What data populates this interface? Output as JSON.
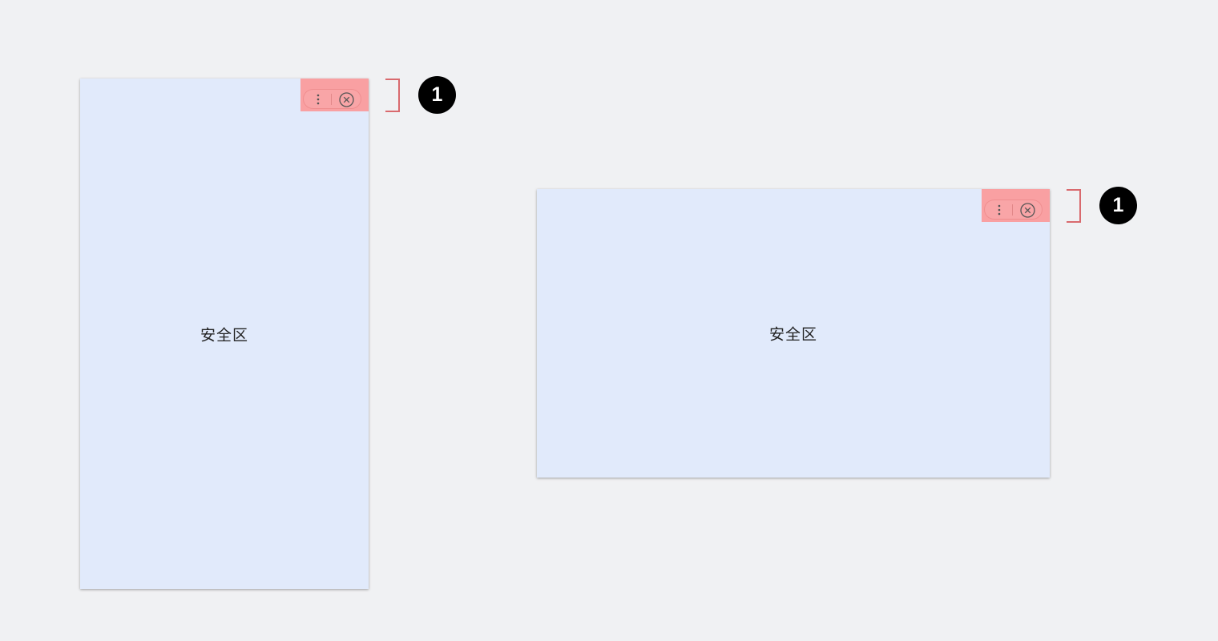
{
  "screens": [
    {
      "orientation": "portrait",
      "safe_area_label": "安全区"
    },
    {
      "orientation": "landscape",
      "safe_area_label": "安全区"
    }
  ],
  "capsule": {
    "menu_icon": "more-vertical-icon",
    "close_icon": "close-circle-icon",
    "highlight_color": "#f9a0a2"
  },
  "annotations": [
    {
      "marker": "1"
    },
    {
      "marker": "1"
    }
  ],
  "colors": {
    "background": "#f0f1f3",
    "screen": "#e1eafb",
    "bracket": "#d96a6e",
    "marker": "#000000"
  }
}
